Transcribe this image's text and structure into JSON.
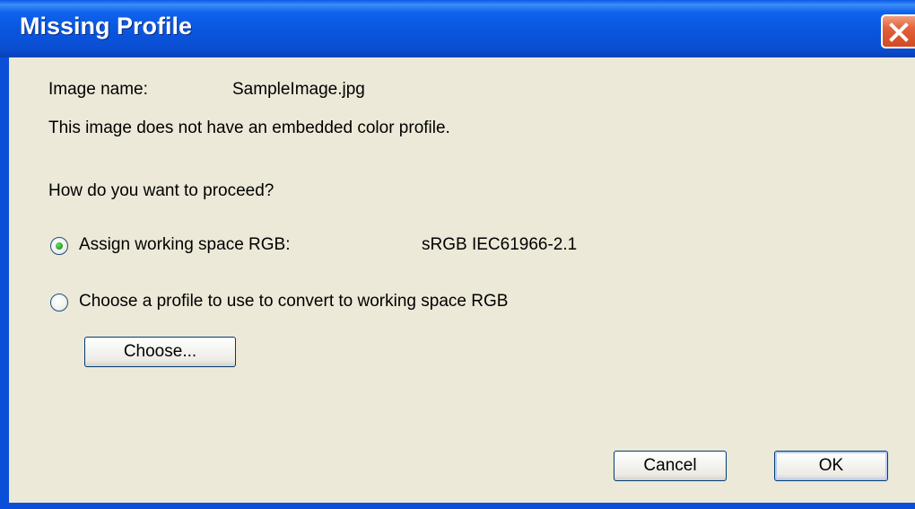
{
  "window": {
    "title": "Missing Profile"
  },
  "dialog": {
    "image_name_label": "Image name:",
    "image_name_value": "SampleImage.jpg",
    "message": "This image does not have an embedded color profile.",
    "question": "How do you want to proceed?",
    "options": [
      {
        "label": "Assign working space RGB:",
        "value": "sRGB IEC61966-2.1",
        "selected": true
      },
      {
        "label": "Choose a profile to use to convert to working space RGB",
        "selected": false
      }
    ],
    "choose_button": "Choose...",
    "cancel_button": "Cancel",
    "ok_button": "OK"
  }
}
